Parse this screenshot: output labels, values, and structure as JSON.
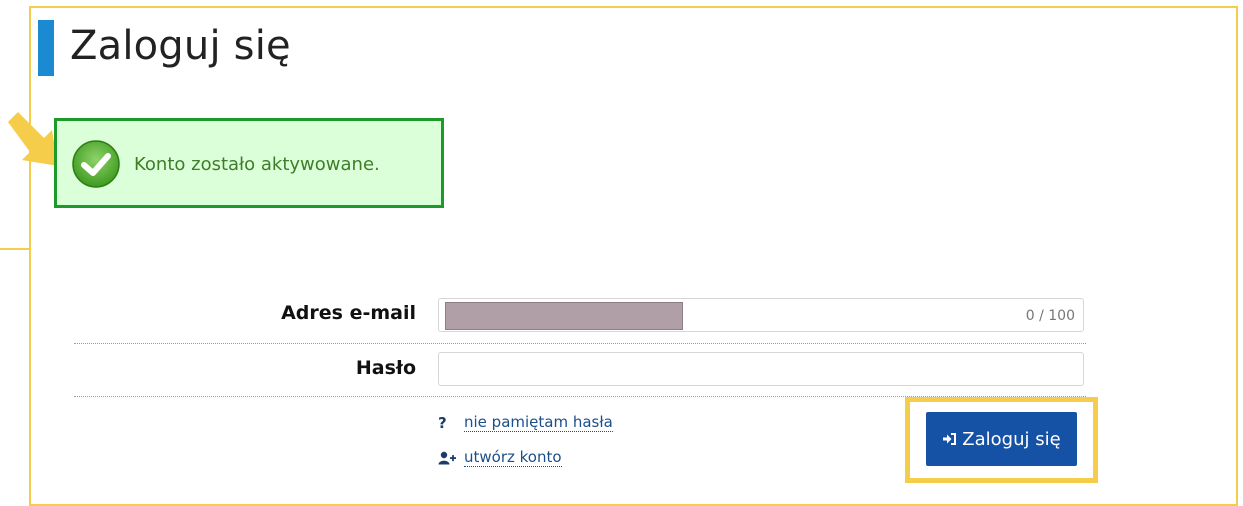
{
  "page": {
    "title": "Zaloguj się"
  },
  "alert": {
    "message": "Konto zostało aktywowane.",
    "icon": "check-circle-icon",
    "color": "#1c9a2a"
  },
  "form": {
    "email_label": "Adres e-mail",
    "email_value": "",
    "email_counter": "0 / 100",
    "password_label": "Hasło",
    "password_value": ""
  },
  "links": {
    "forgot_icon": "?",
    "forgot_label": "nie pamiętam hasła",
    "create_label": "utwórz konto",
    "create_icon": "user-plus-icon"
  },
  "actions": {
    "login_label": "Zaloguj się",
    "login_icon": "sign-in-icon",
    "button_color": "#1552a6"
  },
  "highlight_color": "#f5cd4a"
}
